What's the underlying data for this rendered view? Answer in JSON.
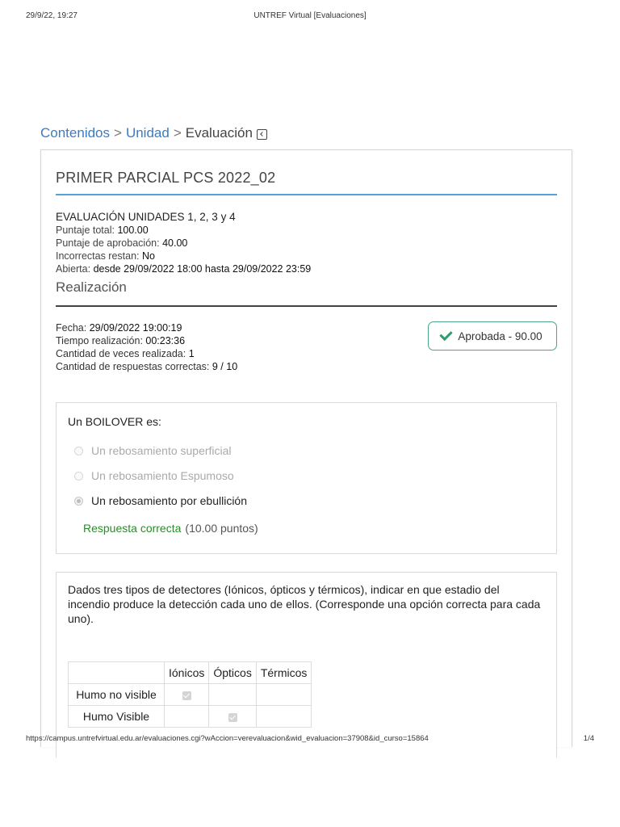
{
  "print_header": {
    "datetime": "29/9/22, 19:27",
    "title": "UNTREF Virtual [Evaluaciones]"
  },
  "breadcrumb": {
    "items": [
      "Contenidos",
      "Unidad"
    ],
    "separator": ">",
    "current": "Evaluación"
  },
  "exam": {
    "title": "PRIMER PARCIAL PCS 2022_02",
    "unit_title": "EVALUACIÓN UNIDADES 1, 2, 3 y 4",
    "total_score_label": "Puntaje total:",
    "total_score": "100.00",
    "pass_score_label": "Puntaje de aprobación:",
    "pass_score": "40.00",
    "wrong_subtract_label": "Incorrectas restan:",
    "wrong_subtract": "No",
    "open_label": "Abierta:",
    "open_value": "desde 29/09/2022 18:00 hasta 29/09/2022 23:59"
  },
  "attempt": {
    "section_title": "Realización",
    "date_label": "Fecha:",
    "date": "29/09/2022 19:00:19",
    "time_label": "Tiempo realización:",
    "time": "00:23:36",
    "times_label": "Cantidad de veces realizada:",
    "times": "1",
    "correct_label": "Cantidad de respuestas correctas:",
    "correct": "9 / 10",
    "status": "Aprobada - 90.00",
    "status_color": "#2e9c6a"
  },
  "question1": {
    "text": "Un BOILOVER es:",
    "options": [
      {
        "label": "Un rebosamiento superficial",
        "selected": false
      },
      {
        "label": "Un rebosamiento Espumoso",
        "selected": false
      },
      {
        "label": "Un rebosamiento por ebullición",
        "selected": true
      }
    ],
    "feedback": "Respuesta correcta",
    "points": "(10.00 puntos)"
  },
  "question2": {
    "text": "Dados tres tipos de detectores (Iónicos, ópticos y térmicos), indicar en que estadio del incendio produce la detección cada uno de ellos. (Corresponde una opción correcta para cada uno).",
    "columns": [
      "Iónicos",
      "Ópticos",
      "Térmicos"
    ],
    "rows": [
      {
        "label": "Humo no visible",
        "checked": [
          true,
          false,
          false
        ]
      },
      {
        "label": "Humo Visible",
        "checked": [
          false,
          true,
          false
        ]
      }
    ]
  },
  "print_footer": {
    "url": "https://campus.untrefvirtual.edu.ar/evaluaciones.cgi?wAccion=verevaluacion&wid_evaluacion=37908&id_curso=15864",
    "page": "1/4"
  }
}
